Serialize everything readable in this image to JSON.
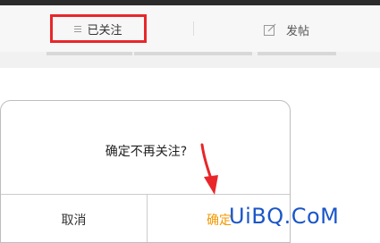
{
  "toolbar": {
    "follow_label": "已关注",
    "post_label": "发帖"
  },
  "dialog": {
    "message": "确定不再关注?",
    "cancel_label": "取消",
    "confirm_label": "确定"
  },
  "watermark": "UiBQ.CoM",
  "colors": {
    "highlight": "#e8262a",
    "confirm": "#f39800",
    "arrow": "#e8262a",
    "watermark": "#1a56c8"
  },
  "icons": [
    "menu-icon",
    "edit-icon",
    "red-arrow-annotation"
  ]
}
